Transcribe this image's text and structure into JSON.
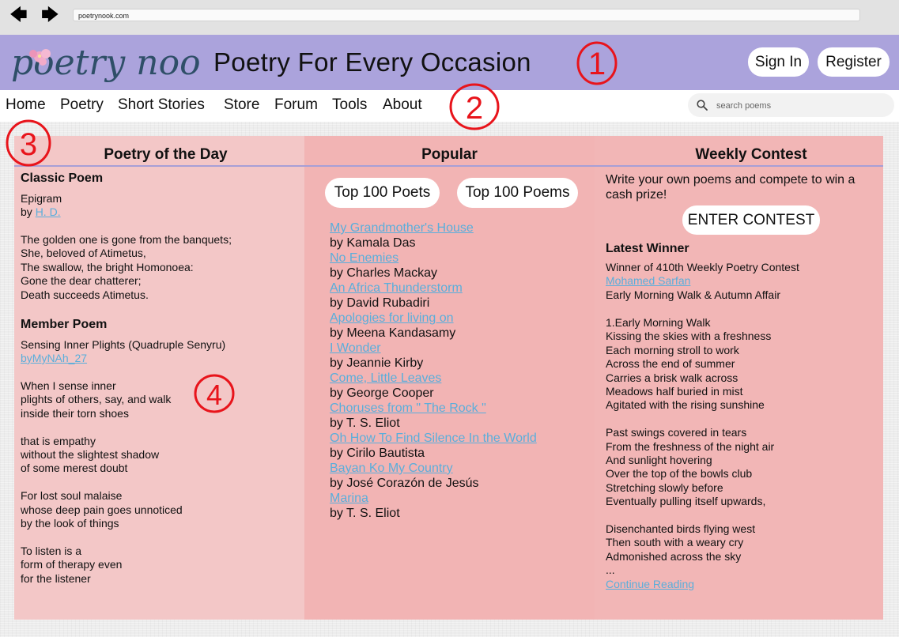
{
  "browser": {
    "url": "poetrynook.com"
  },
  "header": {
    "logo_text": "poetry nook",
    "tagline": "Poetry For Every Occasion",
    "sign_in": "Sign In",
    "register": "Register"
  },
  "nav": {
    "items": [
      "Home",
      "Poetry",
      "Short Stories",
      "Store",
      "Forum",
      "Tools",
      "About"
    ],
    "search_placeholder": "search poems"
  },
  "annotations": [
    "1",
    "2",
    "3",
    "4"
  ],
  "poetry_of_the_day": {
    "title": "Poetry of the Day",
    "classic": {
      "heading": "Classic Poem",
      "poem_title": "Epigram",
      "by_prefix": "by ",
      "author": "H. D.",
      "lines": [
        "The golden one is gone from the banquets;",
        "She, beloved of Atimetus,",
        "The swallow, the bright Homonoea:",
        "Gone the dear chatterer;",
        "Death succeeds Atimetus."
      ]
    },
    "member": {
      "heading": "Member Poem",
      "poem_title": "Sensing Inner Plights (Quadruple Senyru)",
      "author": "byMyNAh_27",
      "stanzas": [
        [
          "When I sense inner",
          "plights of others, say, and walk",
          "inside their torn shoes"
        ],
        [
          "that is empathy",
          "without the slightest shadow",
          "of some merest doubt"
        ],
        [
          "For lost soul malaise",
          "whose deep pain goes unnoticed",
          "by the look of things"
        ],
        [
          "To listen is a",
          "form of therapy even",
          "for the listener"
        ]
      ]
    }
  },
  "popular": {
    "title": "Popular",
    "top_poets": "Top 100 Poets",
    "top_poems": "Top 100 Poems",
    "items": [
      {
        "title": "My Grandmother's House",
        "author": "by Kamala Das"
      },
      {
        "title": "No Enemies",
        "author": "by Charles Mackay"
      },
      {
        "title": "An Africa Thunderstorm",
        "author": "by David Rubadiri"
      },
      {
        "title": "Apologies for living on",
        "author": "by Meena Kandasamy"
      },
      {
        "title": "I Wonder",
        "author": "by Jeannie Kirby"
      },
      {
        "title": "Come, Little Leaves",
        "author": "by George Cooper"
      },
      {
        "title": "Choruses from \" The Rock \"",
        "author": "by T. S. Eliot"
      },
      {
        "title": "Oh How To Find Silence In the World",
        "author": "by Cirilo Bautista"
      },
      {
        "title": "Bayan Ko My Country",
        "author": "by José Corazón de Jesús"
      },
      {
        "title": "Marina",
        "author": "by T. S. Eliot"
      }
    ]
  },
  "contest": {
    "title": "Weekly Contest",
    "intro_1": "Write your own poems and compete to win a",
    "intro_2": "cash prize!",
    "enter_button": "ENTER CONTEST",
    "winner_heading": "Latest Winner",
    "winner_of": "Winner of 410th Weekly Poetry Contest",
    "winner_name": "Mohamed Sarfan",
    "winner_poem": "Early Morning Walk & Autumn Affair",
    "stanzas": [
      [
        "1.Early Morning Walk",
        "Kissing the skies with a freshness",
        "Each morning stroll to work",
        "Across the end of summer",
        "Carries a brisk walk across",
        "Meadows half buried in mist",
        "Agitated with the rising sunshine"
      ],
      [
        "Past swings covered in tears",
        "From the freshness of the night air",
        "And sunlight hovering",
        "Over the top of the bowls club",
        "Stretching slowly before",
        "Eventually pulling itself upwards,"
      ],
      [
        "Disenchanted birds flying west",
        "Then south with a weary cry",
        "Admonished across the sky",
        "..."
      ]
    ],
    "continue_reading": "Continue Reading"
  },
  "colors": {
    "header_bg": "#aba3dc",
    "panel_bg": "#f2b4b4",
    "link": "#5aaedb",
    "annotation_red": "#e8141b"
  }
}
